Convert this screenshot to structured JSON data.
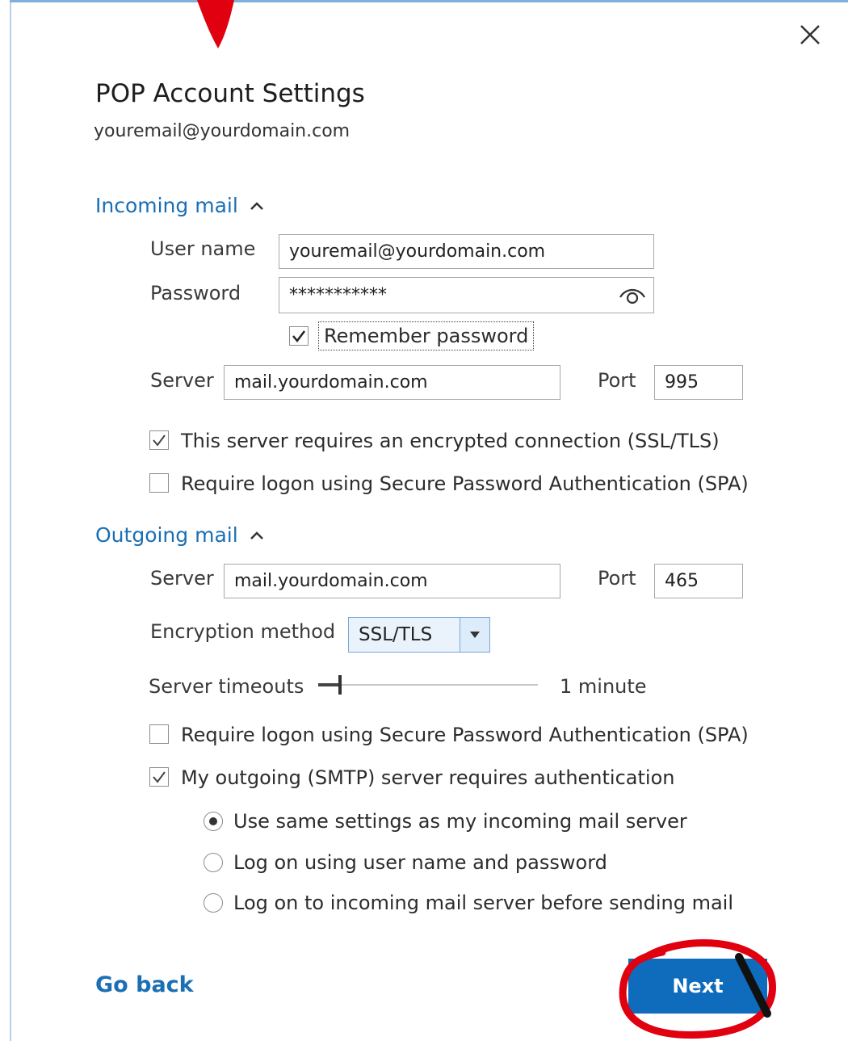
{
  "dialog": {
    "title": "POP Account Settings",
    "account_email": "youremail@yourdomain.com",
    "close_icon": "close-icon"
  },
  "incoming": {
    "section_label": "Incoming mail",
    "username_label": "User name",
    "username_value": "youremail@yourdomain.com",
    "password_label": "Password",
    "password_value": "***********",
    "remember_password_label": "Remember password",
    "remember_password_checked": true,
    "server_label": "Server",
    "server_value": "mail.yourdomain.com",
    "port_label": "Port",
    "port_value": "995",
    "ssl_label": "This server requires an encrypted connection (SSL/TLS)",
    "ssl_checked": true,
    "spa_label": "Require logon using Secure Password Authentication (SPA)",
    "spa_checked": false
  },
  "outgoing": {
    "section_label": "Outgoing mail",
    "server_label": "Server",
    "server_value": "mail.yourdomain.com",
    "port_label": "Port",
    "port_value": "465",
    "encryption_label": "Encryption method",
    "encryption_value": "SSL/TLS",
    "timeouts_label": "Server timeouts",
    "timeouts_value": "1 minute",
    "spa_label": "Require logon using Secure Password Authentication (SPA)",
    "spa_checked": false,
    "smtp_auth_label": "My outgoing (SMTP) server requires authentication",
    "smtp_auth_checked": true,
    "auth_options": [
      {
        "label": "Use same settings as my incoming mail server",
        "selected": true
      },
      {
        "label": "Log on using user name and password",
        "selected": false
      },
      {
        "label": "Log on to incoming mail server before sending mail",
        "selected": false
      }
    ]
  },
  "footer": {
    "go_back_label": "Go back",
    "next_label": "Next"
  },
  "colors": {
    "accent": "#1a6fb5",
    "button": "#0f6cbd",
    "annotation": "#e0000f"
  }
}
